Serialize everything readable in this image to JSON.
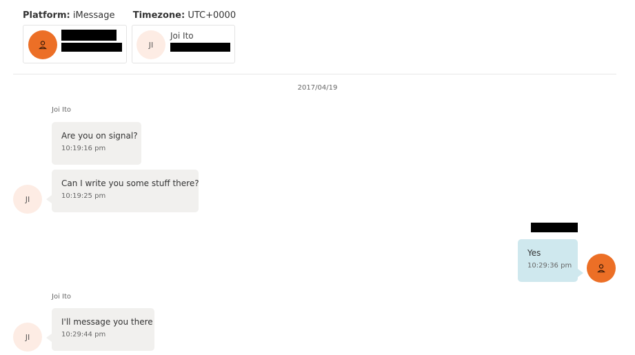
{
  "header": {
    "platform_label": "Platform:",
    "platform_value": "iMessage",
    "timezone_label": "Timezone:",
    "timezone_value": "UTC+0000"
  },
  "participants": [
    {
      "id": "self",
      "avatar_icon": "person-icon",
      "name": "",
      "redacted": true
    },
    {
      "id": "other",
      "initials": "JI",
      "name": "Joi Ito",
      "redacted_detail": true
    }
  ],
  "date_separator": "2017/04/19",
  "messages": [
    {
      "sender": "Joi Ito",
      "text": "Are you on signal?",
      "time": "10:19:16 pm",
      "direction": "incoming"
    },
    {
      "sender": "Joi Ito",
      "text": "Can I write you some stuff there?",
      "time": "10:19:25 pm",
      "direction": "incoming",
      "initials": "JI"
    },
    {
      "sender": "",
      "text": "Yes",
      "time": "10:29:36 pm",
      "direction": "outgoing"
    },
    {
      "sender": "Joi Ito",
      "text": "I'll message you there",
      "time": "10:29:44 pm",
      "direction": "incoming",
      "initials": "JI"
    }
  ],
  "colors": {
    "self_avatar": "#ec6f26",
    "other_avatar": "#fdece4",
    "incoming_bubble": "#f1f0ee",
    "outgoing_bubble": "#cfe8ee"
  }
}
